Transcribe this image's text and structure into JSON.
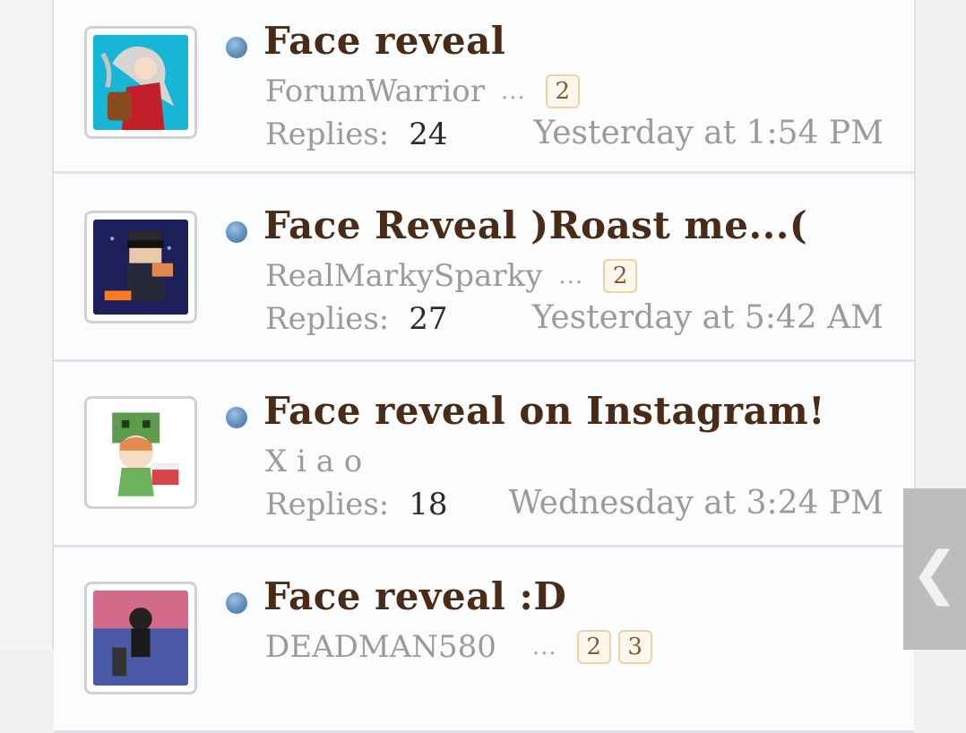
{
  "threads": [
    {
      "title": "Face reveal",
      "author": "ForumWarrior",
      "ellipsis": "...",
      "pages": [
        "2"
      ],
      "replies_label": "Replies:",
      "replies": "24",
      "last_post": "Yesterday at 1:54 PM"
    },
    {
      "title": "Face Reveal )Roast me...(",
      "author": "RealMarkySparky",
      "ellipsis": "...",
      "pages": [
        "2"
      ],
      "replies_label": "Replies:",
      "replies": "27",
      "last_post": "Yesterday at 5:42 AM"
    },
    {
      "title": "Face reveal on Instagram!",
      "author": "X i a o",
      "replies_label": "Replies:",
      "replies": "18",
      "last_post": "Wednesday at 3:24 PM"
    },
    {
      "title": "Face reveal :D",
      "author": "DEADMAN580",
      "ellipsis": "...",
      "pages": [
        "2",
        "3"
      ]
    }
  ],
  "side_tab": {
    "icon": "chevron-left-icon",
    "glyph": "❮"
  },
  "colors": {
    "title": "#4a2c16",
    "muted": "#9b9b9b",
    "badge_border": "#f0d2a0",
    "status_dot": "#5f8fbd"
  }
}
